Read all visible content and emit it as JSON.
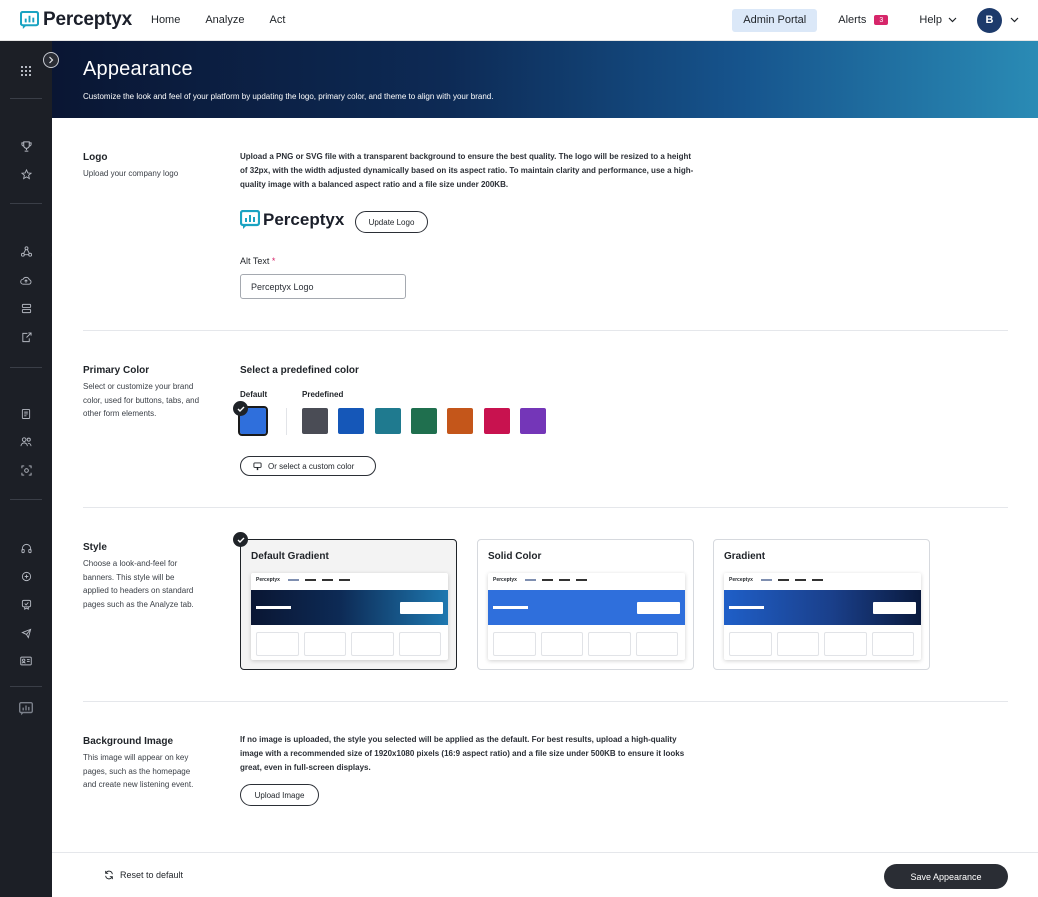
{
  "topnav": {
    "brand": "Perceptyx",
    "links": [
      "Home",
      "Analyze",
      "Act"
    ],
    "admin_portal": "Admin Portal",
    "alerts_label": "Alerts",
    "alerts_count": "3",
    "help_label": "Help",
    "avatar_initial": "B"
  },
  "banner": {
    "title": "Appearance",
    "subtitle": "Customize the look and feel of your platform by updating the logo, primary color, and theme to align with your brand."
  },
  "logo_section": {
    "label": "Logo",
    "desc": "Upload your company logo",
    "instructions": "Upload a PNG or SVG file with a transparent background to ensure the best quality. The logo will be resized to a height of 32px, with the width adjusted dynamically based on its aspect ratio. To maintain clarity and performance, use a high-quality image with a balanced aspect ratio and a file size under 200KB.",
    "preview_text": "Perceptyx",
    "update_button": "Update Logo",
    "alt_text_label": "Alt Text",
    "alt_text_required": "*",
    "alt_text_value": "Perceptyx Logo"
  },
  "primary_color": {
    "label": "Primary Color",
    "desc": "Select or customize your brand color, used for buttons, tabs, and other form elements.",
    "heading": "Select a predefined color",
    "default_label": "Default",
    "predefined_label": "Predefined",
    "default_color": "#2f6fdc",
    "selected": "default",
    "predefined_colors": [
      "#4a4c55",
      "#1557b8",
      "#1f7a8f",
      "#1f6f4e",
      "#c4561a",
      "#c8124f",
      "#7436b8"
    ],
    "custom_button": "Or select a custom color"
  },
  "style": {
    "label": "Style",
    "desc": "Choose a look-and-feel for banners. This style will be applied to headers on standard pages such as the Analyze tab.",
    "selected": "Default Gradient",
    "cards": [
      {
        "title": "Default Gradient",
        "banner_style": "linear-gradient(90deg, #0a1633 0%, #0d2a55 45%, #1e78b0 100%)"
      },
      {
        "title": "Solid Color",
        "banner_style": "#2f6fdc"
      },
      {
        "title": "Gradient",
        "banner_style": "linear-gradient(90deg, #1f5fc8 0%, #1a3f8a 55%, #0a1a3e 100%)"
      }
    ],
    "mini_logo": "Perceptyx"
  },
  "background_image": {
    "label": "Background Image",
    "desc": "This image will appear on key pages, such as the homepage and create new listening event.",
    "instructions": "If no image is uploaded, the style you selected will be applied as the default. For best results, upload a high-quality image with a recommended size of 1920x1080 pixels (16:9 aspect ratio) and a file size under 500KB to ensure it looks great, even in full-screen displays.",
    "upload_button": "Upload Image"
  },
  "footer": {
    "reset": "Reset to default",
    "save": "Save Appearance"
  },
  "sidebar": {
    "icons": [
      "grid-icon",
      "trophy-icon",
      "star-icon",
      "network-icon",
      "cloud-upload-icon",
      "database-icon",
      "export-icon",
      "clipboard-icon",
      "users-icon",
      "scan-icon",
      "headset-icon",
      "chat-icon",
      "badge-icon",
      "megaphone-icon",
      "id-card-icon",
      "chart-logo-icon"
    ]
  }
}
